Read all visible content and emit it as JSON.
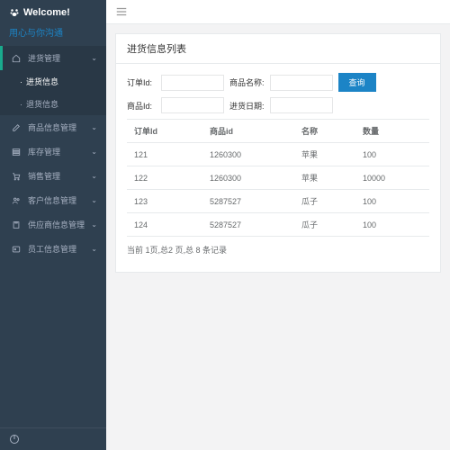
{
  "header": {
    "welcome": "Welcome!",
    "slogan": "用心与你沟通"
  },
  "sidebar": {
    "items": [
      {
        "label": "进货管理",
        "icon": "home"
      },
      {
        "label": "商品信息管理",
        "icon": "edit"
      },
      {
        "label": "库存管理",
        "icon": "layers"
      },
      {
        "label": "销售管理",
        "icon": "cart"
      },
      {
        "label": "客户信息管理",
        "icon": "users"
      },
      {
        "label": "供应商信息管理",
        "icon": "clipboard"
      },
      {
        "label": "员工信息管理",
        "icon": "id"
      }
    ],
    "sub": [
      {
        "label": "进货信息"
      },
      {
        "label": "退货信息"
      }
    ]
  },
  "panel": {
    "title": "进货信息列表"
  },
  "form": {
    "order_label": "订单Id:",
    "goods_name_label": "商品名称:",
    "goods_id_label": "商品Id:",
    "date_label": "进货日期:",
    "search_btn": "查询"
  },
  "table": {
    "headers": [
      "订单Id",
      "商品id",
      "名称",
      "数量"
    ],
    "rows": [
      [
        "121",
        "1260300",
        "苹果",
        "100"
      ],
      [
        "122",
        "1260300",
        "苹果",
        "10000"
      ],
      [
        "123",
        "5287527",
        "瓜子",
        "100"
      ],
      [
        "124",
        "5287527",
        "瓜子",
        "100"
      ]
    ]
  },
  "pager": {
    "text": "当前 1页,总2 页,总 8 条记录"
  }
}
